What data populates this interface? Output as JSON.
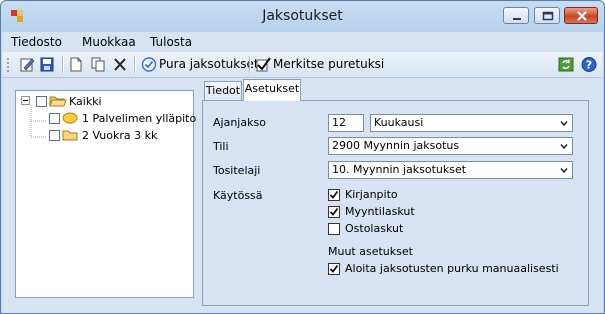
{
  "window": {
    "title": "Jaksotukset"
  },
  "menu": [
    "Tiedosto",
    "Muokkaa",
    "Tulosta"
  ],
  "toolbar": {
    "pura_label": "Pura jaksotukset",
    "merkitse_label": "Merkitse puretuksi"
  },
  "tree": {
    "root": "Kaikki",
    "children": [
      "1 Palvelimen ylläpito",
      "2 Vuokra 3 kk"
    ]
  },
  "tabs": [
    "Tiedot",
    "Asetukset"
  ],
  "form": {
    "ajanjakso_label": "Ajanjakso",
    "ajanjakso_value": "12",
    "ajanjakso_unit": "Kuukausi",
    "tili_label": "Tili",
    "tili_value": "2900 Myynnin jaksotus",
    "tositelaji_label": "Tositelaji",
    "tositelaji_value": "10. Myynnin jaksotukset",
    "kaytossa_label": "Käytössä",
    "checks": [
      {
        "label": "Kirjanpito",
        "checked": true
      },
      {
        "label": "Myyntilaskut",
        "checked": true
      },
      {
        "label": "Ostolaskut",
        "checked": false
      }
    ],
    "muut_label": "Muut asetukset",
    "manual_label": "Aloita jaksotusten purku manuaalisesti",
    "manual_checked": true
  }
}
